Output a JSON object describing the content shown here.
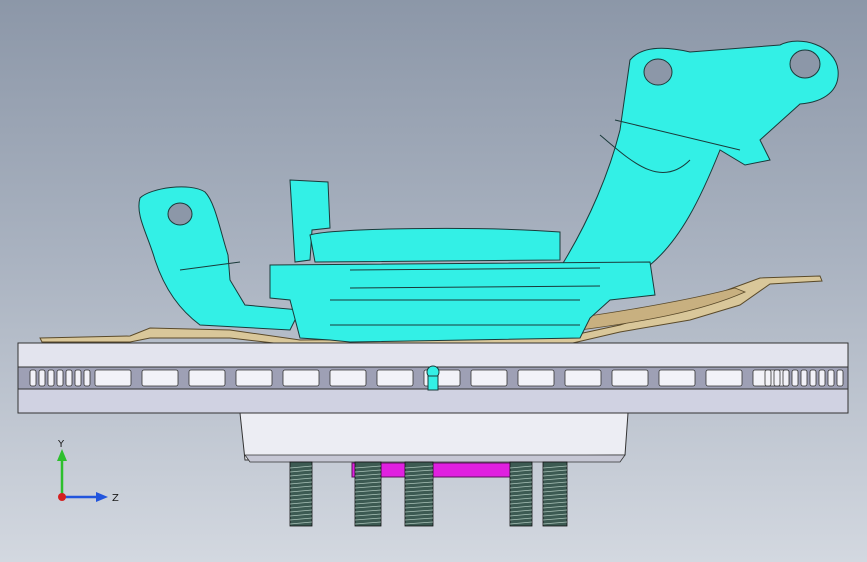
{
  "viewport": {
    "background_top": "#8c97a8",
    "background_bottom": "#d3d8e0"
  },
  "colors": {
    "knuckle": "#33f0e6",
    "knuckle_edge": "#1a3a3a",
    "dust_shield": "#d9c79a",
    "rotor": "#d9dbe8",
    "hub": "#e6e7ef",
    "studs": "#3c5a52",
    "sensor_ring": "#e020e0"
  },
  "triad": {
    "y_label": "Y",
    "z_label": "Z",
    "y_color": "#2dbf2d",
    "z_color": "#2255dd",
    "x_color": "#d42020"
  }
}
